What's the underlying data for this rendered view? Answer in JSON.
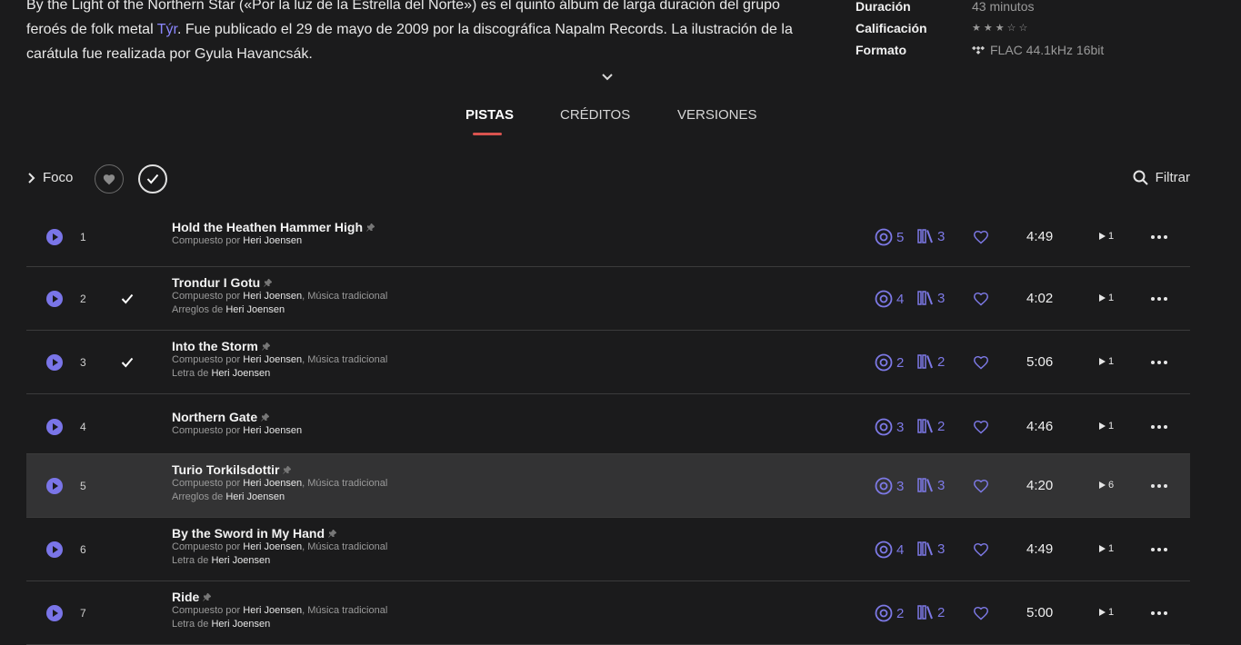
{
  "description": {
    "text_before": "By the Light of the Northern Star («Por la luz de la Estrella del Norte») es el quinto álbum de larga duración del grupo feroés de folk metal ",
    "link": "Týr",
    "text_after": ". Fue publicado el 29 de mayo de 2009 por la discográfica Napalm Records. La ilustración de la carátula fue realizada por Gyula Havancsák."
  },
  "meta": {
    "duration_label": "Duración",
    "duration_value": "43 minutos",
    "rating_label": "Calificación",
    "rating_value": 3,
    "rating_max": 5,
    "format_label": "Formato",
    "format_value": "FLAC 44.1kHz 16bit"
  },
  "tabs": [
    "PISTAS",
    "CRÉDITOS",
    "VERSIONES"
  ],
  "active_tab": "PISTAS",
  "toolbar": {
    "foco_label": "Foco",
    "filter_label": "Filtrar"
  },
  "labels": {
    "composed_by": "Compuesto por",
    "arranged_by": "Arreglos de",
    "lyrics_by": "Letra de"
  },
  "colors": {
    "accent": "#7d79e6",
    "tab_underline": "#d9534f",
    "background": "#1b1b1c",
    "highlight_row": "#333334"
  },
  "tracks": [
    {
      "num": "1",
      "checked": false,
      "title": "Hold the Heathen Hammer High",
      "composers": [
        {
          "t": "Heri Joensen",
          "bold": true
        }
      ],
      "extra_label": "",
      "extra_name": "",
      "listens": "5",
      "versions": "3",
      "duration": "4:49",
      "plays": "1"
    },
    {
      "num": "2",
      "checked": true,
      "title": "Trondur I Gotu",
      "composers": [
        {
          "t": "Heri Joensen",
          "bold": true
        },
        {
          "t": ", ",
          "bold": false
        },
        {
          "t": "Música tradicional",
          "bold": false
        }
      ],
      "extra_label": "Arreglos de",
      "extra_name": "Heri Joensen",
      "listens": "4",
      "versions": "3",
      "duration": "4:02",
      "plays": "1"
    },
    {
      "num": "3",
      "checked": true,
      "title": "Into the Storm",
      "composers": [
        {
          "t": "Heri Joensen",
          "bold": true
        },
        {
          "t": ", ",
          "bold": false
        },
        {
          "t": "Música tradicional",
          "bold": false
        }
      ],
      "extra_label": "Letra de",
      "extra_name": "Heri Joensen",
      "listens": "2",
      "versions": "2",
      "duration": "5:06",
      "plays": "1"
    },
    {
      "num": "4",
      "checked": false,
      "title": "Northern Gate",
      "composers": [
        {
          "t": "Heri Joensen",
          "bold": true
        }
      ],
      "extra_label": "",
      "extra_name": "",
      "listens": "3",
      "versions": "2",
      "duration": "4:46",
      "plays": "1"
    },
    {
      "num": "5",
      "checked": false,
      "highlighted": true,
      "title": "Turio Torkilsdottir",
      "composers": [
        {
          "t": "Heri Joensen",
          "bold": true
        },
        {
          "t": ", ",
          "bold": false
        },
        {
          "t": "Música tradicional",
          "bold": false
        }
      ],
      "extra_label": "Arreglos de",
      "extra_name": "Heri Joensen",
      "listens": "3",
      "versions": "3",
      "duration": "4:20",
      "plays": "6"
    },
    {
      "num": "6",
      "checked": false,
      "title": "By the Sword in My Hand",
      "composers": [
        {
          "t": "Heri Joensen",
          "bold": true
        },
        {
          "t": ", ",
          "bold": false
        },
        {
          "t": "Música tradicional",
          "bold": false
        }
      ],
      "extra_label": "Letra de",
      "extra_name": "Heri Joensen",
      "listens": "4",
      "versions": "3",
      "duration": "4:49",
      "plays": "1"
    },
    {
      "num": "7",
      "checked": false,
      "title": "Ride",
      "composers": [
        {
          "t": "Heri Joensen",
          "bold": true
        },
        {
          "t": ", ",
          "bold": false
        },
        {
          "t": "Música tradicional",
          "bold": false
        }
      ],
      "extra_label": "Letra de",
      "extra_name": "Heri Joensen",
      "listens": "2",
      "versions": "2",
      "duration": "5:00",
      "plays": "1"
    }
  ]
}
